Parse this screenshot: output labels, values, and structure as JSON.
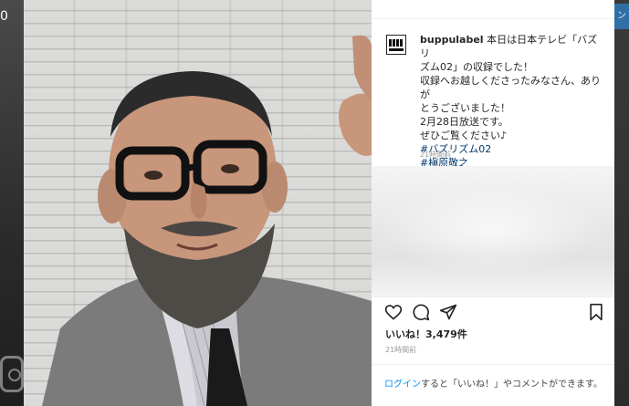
{
  "background": {
    "left_char": "0",
    "top_right_link": "ン"
  },
  "post": {
    "username": "buppulabel",
    "caption_lines": [
      "本日は日本テレビ「バズリ",
      "ズム02」の収録でした！",
      "収録へお越しくださったみなさん、ありが",
      "とうございました！",
      "2月28日放送です。",
      "ぜひご覧ください♪"
    ],
    "hashtags": [
      "#バズリズム02",
      "#槇原敬之"
    ],
    "caption_time": "21時間前",
    "likes_prefix": "いいね！",
    "likes_count": "3,479件",
    "post_time": "21時間前",
    "login": {
      "link": "ログイン",
      "rest": "すると「いいね！」やコメントができます。"
    }
  },
  "icons": {
    "like": "heart-icon",
    "comment": "comment-icon",
    "share": "share-icon",
    "save": "bookmark-icon",
    "avatar": "buppu-label-logo"
  },
  "colors": {
    "link": "#0095f6",
    "hashtag": "#00376b",
    "text": "#262626",
    "muted": "#9a9a9a"
  }
}
